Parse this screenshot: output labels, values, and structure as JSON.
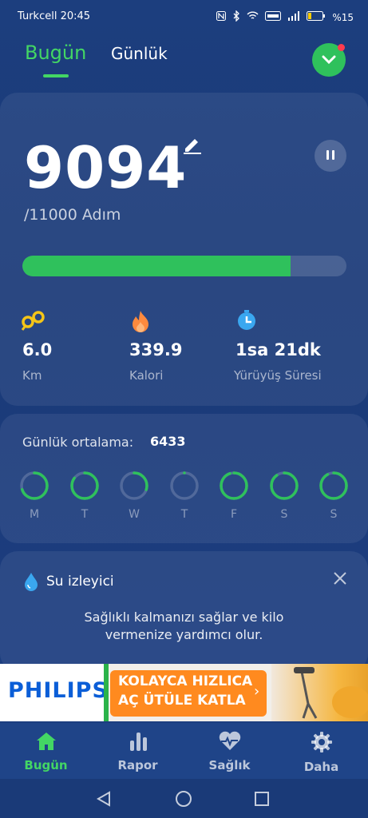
{
  "status": {
    "carrier_time": "Turkcell 20:45",
    "battery": "%15"
  },
  "tabs": {
    "today": "Bugün",
    "daily": "Günlük"
  },
  "steps": {
    "count": "9094",
    "goal_text": "/11000 Adım",
    "progress": 0.827
  },
  "stats": [
    {
      "icon": "distance-icon",
      "value": "6.0",
      "label": "Km"
    },
    {
      "icon": "flame-icon",
      "value": "339.9",
      "label": "Kalori"
    },
    {
      "icon": "stopwatch-icon",
      "value": "1sa 21dk",
      "label": "Yürüyüş Süresi"
    }
  ],
  "weekly": {
    "label": "Günlük ortalama:",
    "value": "6433",
    "days": [
      {
        "label": "M",
        "progress": 0.7
      },
      {
        "label": "T",
        "progress": 0.85
      },
      {
        "label": "W",
        "progress": 0.3
      },
      {
        "label": "T",
        "progress": 0.0
      },
      {
        "label": "F",
        "progress": 0.95
      },
      {
        "label": "S",
        "progress": 0.9
      },
      {
        "label": "S",
        "progress": 0.92
      }
    ]
  },
  "water": {
    "title": "Su izleyici",
    "description": "Sağlıklı kalmanızı sağlar ve kilo vermenize yardımcı olur."
  },
  "ad": {
    "brand": "PHILIPS",
    "line1": "KOLAYCA HIZLICA",
    "line2": "AÇ ÜTÜLE KATLA",
    "arrow": "›"
  },
  "nav": [
    {
      "icon": "home-icon",
      "label": "Bugün",
      "active": true
    },
    {
      "icon": "chart-icon",
      "label": "Rapor",
      "active": false
    },
    {
      "icon": "heart-pulse-icon",
      "label": "Sağlık",
      "active": false
    },
    {
      "icon": "gear-icon",
      "label": "Daha",
      "active": false
    }
  ],
  "colors": {
    "accent": "#43d664",
    "background": "#1c3e7e",
    "ring": "#2fc15c",
    "ad_orange": "#ff8a1f",
    "brand_blue": "#0b5ed7"
  }
}
